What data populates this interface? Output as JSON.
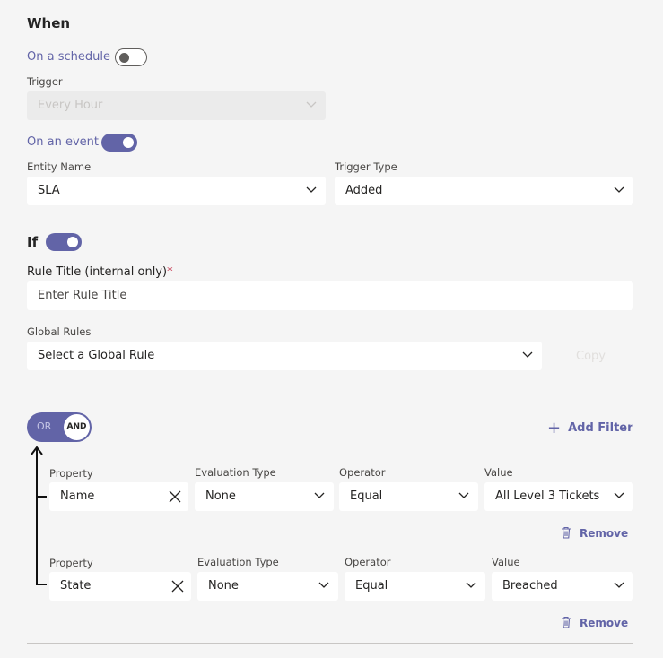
{
  "when": {
    "heading": "When",
    "schedule_label": "On a schedule",
    "schedule_enabled": false,
    "trigger_label": "Trigger",
    "trigger_value": "Every Hour",
    "event_label": "On an event",
    "event_enabled": true,
    "entity_label": "Entity Name",
    "entity_value": "SLA",
    "trigger_type_label": "Trigger Type",
    "trigger_type_value": "Added"
  },
  "if": {
    "heading": "If",
    "enabled": true,
    "rule_title_label": "Rule Title (internal only)",
    "required_mark": "*",
    "rule_title_placeholder": "Enter Rule Title",
    "global_rules_label": "Global Rules",
    "global_rule_value": "Select a Global Rule",
    "copy_label": "Copy"
  },
  "logic": {
    "or_label": "OR",
    "and_label": "AND",
    "selected": "AND",
    "add_filter_label": "Add Filter"
  },
  "filters": [
    {
      "property_label": "Property",
      "property_value": "Name",
      "eval_label": "Evaluation Type",
      "eval_value": "None",
      "operator_label": "Operator",
      "operator_value": "Equal",
      "value_label": "Value",
      "value_value": "All Level 3 Tickets",
      "remove_label": "Remove"
    },
    {
      "property_label": "Property",
      "property_value": "State",
      "eval_label": "Evaluation Type",
      "eval_value": "None",
      "operator_label": "Operator",
      "operator_value": "Equal",
      "value_label": "Value",
      "value_value": "Breached",
      "remove_label": "Remove"
    }
  ],
  "colors": {
    "accent": "#6264a7",
    "background": "#f5f5f5",
    "field": "#ffffff",
    "required": "#c4314b"
  },
  "icons": [
    "chevron-down-icon",
    "close-icon",
    "trash-icon",
    "plus-icon",
    "arrow-up-icon"
  ]
}
